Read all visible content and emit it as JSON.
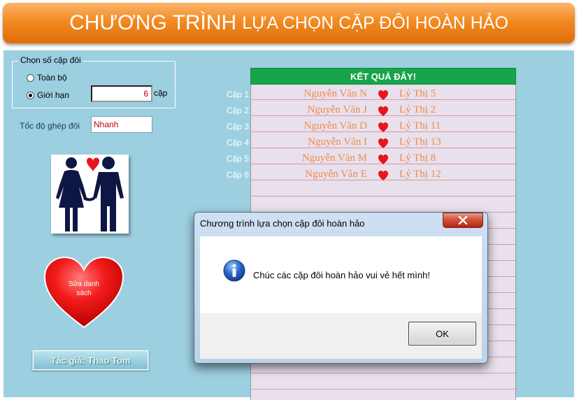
{
  "header": {
    "title_big": "CHƯƠNG TRÌNH",
    "title_small": "LỰA CHỌN CẶP ĐÔI HOÀN HẢO"
  },
  "options": {
    "group_label": "Chọn số cặp đôi",
    "all_label": "Toàn bộ",
    "limit_label": "Giới hạn",
    "limit_value": "6",
    "unit_label": "cặp",
    "selected": "limit",
    "speed_label": "Tốc độ ghép đôi",
    "speed_value": "Nhanh"
  },
  "buttons": {
    "edit_list": "Sửa danh sách",
    "author": "Tác giả: Thao Tom"
  },
  "results": {
    "header": "KẾT QUẢ ĐÂY!",
    "pairs": [
      {
        "label": "Cặp 1",
        "male": "Nguyễn Văn N",
        "female": "Lý Thị 5"
      },
      {
        "label": "Cặp 2",
        "male": "Nguyễn Văn J",
        "female": "Lý Thị 2"
      },
      {
        "label": "Cặp 3",
        "male": "Nguyễn Văn D",
        "female": "Lý Thị 11"
      },
      {
        "label": "Cặp 4",
        "male": "Nguyễn Văn I",
        "female": "Lý Thị 13"
      },
      {
        "label": "Cặp 5",
        "male": "Nguyễn Văn M",
        "female": "Lý Thị 8"
      },
      {
        "label": "Cặp 6",
        "male": "Nguyễn Văn E",
        "female": "Lý Thị 12"
      }
    ]
  },
  "dialog": {
    "title": "Chương trình lựa chọn cặp đôi hoàn hảo",
    "message": "Chúc các cặp đôi hoàn hảo vui vẻ hết mình!",
    "ok_label": "OK"
  },
  "icons": {
    "heart": "heart-icon",
    "info": "info-icon",
    "close": "close-icon"
  },
  "colors": {
    "heart": "#e8141e",
    "results_header": "#17a44a",
    "names": "#f08a4b"
  }
}
